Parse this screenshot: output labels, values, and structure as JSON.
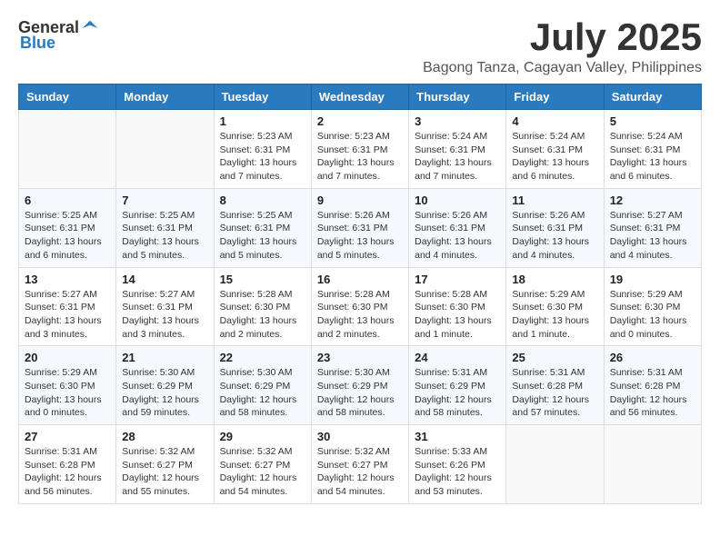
{
  "logo": {
    "general": "General",
    "blue": "Blue"
  },
  "title": "July 2025",
  "location": "Bagong Tanza, Cagayan Valley, Philippines",
  "weekdays": [
    "Sunday",
    "Monday",
    "Tuesday",
    "Wednesday",
    "Thursday",
    "Friday",
    "Saturday"
  ],
  "weeks": [
    [
      {
        "day": "",
        "sunrise": "",
        "sunset": "",
        "daylight": ""
      },
      {
        "day": "",
        "sunrise": "",
        "sunset": "",
        "daylight": ""
      },
      {
        "day": "1",
        "sunrise": "Sunrise: 5:23 AM",
        "sunset": "Sunset: 6:31 PM",
        "daylight": "Daylight: 13 hours and 7 minutes."
      },
      {
        "day": "2",
        "sunrise": "Sunrise: 5:23 AM",
        "sunset": "Sunset: 6:31 PM",
        "daylight": "Daylight: 13 hours and 7 minutes."
      },
      {
        "day": "3",
        "sunrise": "Sunrise: 5:24 AM",
        "sunset": "Sunset: 6:31 PM",
        "daylight": "Daylight: 13 hours and 7 minutes."
      },
      {
        "day": "4",
        "sunrise": "Sunrise: 5:24 AM",
        "sunset": "Sunset: 6:31 PM",
        "daylight": "Daylight: 13 hours and 6 minutes."
      },
      {
        "day": "5",
        "sunrise": "Sunrise: 5:24 AM",
        "sunset": "Sunset: 6:31 PM",
        "daylight": "Daylight: 13 hours and 6 minutes."
      }
    ],
    [
      {
        "day": "6",
        "sunrise": "Sunrise: 5:25 AM",
        "sunset": "Sunset: 6:31 PM",
        "daylight": "Daylight: 13 hours and 6 minutes."
      },
      {
        "day": "7",
        "sunrise": "Sunrise: 5:25 AM",
        "sunset": "Sunset: 6:31 PM",
        "daylight": "Daylight: 13 hours and 5 minutes."
      },
      {
        "day": "8",
        "sunrise": "Sunrise: 5:25 AM",
        "sunset": "Sunset: 6:31 PM",
        "daylight": "Daylight: 13 hours and 5 minutes."
      },
      {
        "day": "9",
        "sunrise": "Sunrise: 5:26 AM",
        "sunset": "Sunset: 6:31 PM",
        "daylight": "Daylight: 13 hours and 5 minutes."
      },
      {
        "day": "10",
        "sunrise": "Sunrise: 5:26 AM",
        "sunset": "Sunset: 6:31 PM",
        "daylight": "Daylight: 13 hours and 4 minutes."
      },
      {
        "day": "11",
        "sunrise": "Sunrise: 5:26 AM",
        "sunset": "Sunset: 6:31 PM",
        "daylight": "Daylight: 13 hours and 4 minutes."
      },
      {
        "day": "12",
        "sunrise": "Sunrise: 5:27 AM",
        "sunset": "Sunset: 6:31 PM",
        "daylight": "Daylight: 13 hours and 4 minutes."
      }
    ],
    [
      {
        "day": "13",
        "sunrise": "Sunrise: 5:27 AM",
        "sunset": "Sunset: 6:31 PM",
        "daylight": "Daylight: 13 hours and 3 minutes."
      },
      {
        "day": "14",
        "sunrise": "Sunrise: 5:27 AM",
        "sunset": "Sunset: 6:31 PM",
        "daylight": "Daylight: 13 hours and 3 minutes."
      },
      {
        "day": "15",
        "sunrise": "Sunrise: 5:28 AM",
        "sunset": "Sunset: 6:30 PM",
        "daylight": "Daylight: 13 hours and 2 minutes."
      },
      {
        "day": "16",
        "sunrise": "Sunrise: 5:28 AM",
        "sunset": "Sunset: 6:30 PM",
        "daylight": "Daylight: 13 hours and 2 minutes."
      },
      {
        "day": "17",
        "sunrise": "Sunrise: 5:28 AM",
        "sunset": "Sunset: 6:30 PM",
        "daylight": "Daylight: 13 hours and 1 minute."
      },
      {
        "day": "18",
        "sunrise": "Sunrise: 5:29 AM",
        "sunset": "Sunset: 6:30 PM",
        "daylight": "Daylight: 13 hours and 1 minute."
      },
      {
        "day": "19",
        "sunrise": "Sunrise: 5:29 AM",
        "sunset": "Sunset: 6:30 PM",
        "daylight": "Daylight: 13 hours and 0 minutes."
      }
    ],
    [
      {
        "day": "20",
        "sunrise": "Sunrise: 5:29 AM",
        "sunset": "Sunset: 6:30 PM",
        "daylight": "Daylight: 13 hours and 0 minutes."
      },
      {
        "day": "21",
        "sunrise": "Sunrise: 5:30 AM",
        "sunset": "Sunset: 6:29 PM",
        "daylight": "Daylight: 12 hours and 59 minutes."
      },
      {
        "day": "22",
        "sunrise": "Sunrise: 5:30 AM",
        "sunset": "Sunset: 6:29 PM",
        "daylight": "Daylight: 12 hours and 58 minutes."
      },
      {
        "day": "23",
        "sunrise": "Sunrise: 5:30 AM",
        "sunset": "Sunset: 6:29 PM",
        "daylight": "Daylight: 12 hours and 58 minutes."
      },
      {
        "day": "24",
        "sunrise": "Sunrise: 5:31 AM",
        "sunset": "Sunset: 6:29 PM",
        "daylight": "Daylight: 12 hours and 58 minutes."
      },
      {
        "day": "25",
        "sunrise": "Sunrise: 5:31 AM",
        "sunset": "Sunset: 6:28 PM",
        "daylight": "Daylight: 12 hours and 57 minutes."
      },
      {
        "day": "26",
        "sunrise": "Sunrise: 5:31 AM",
        "sunset": "Sunset: 6:28 PM",
        "daylight": "Daylight: 12 hours and 56 minutes."
      }
    ],
    [
      {
        "day": "27",
        "sunrise": "Sunrise: 5:31 AM",
        "sunset": "Sunset: 6:28 PM",
        "daylight": "Daylight: 12 hours and 56 minutes."
      },
      {
        "day": "28",
        "sunrise": "Sunrise: 5:32 AM",
        "sunset": "Sunset: 6:27 PM",
        "daylight": "Daylight: 12 hours and 55 minutes."
      },
      {
        "day": "29",
        "sunrise": "Sunrise: 5:32 AM",
        "sunset": "Sunset: 6:27 PM",
        "daylight": "Daylight: 12 hours and 54 minutes."
      },
      {
        "day": "30",
        "sunrise": "Sunrise: 5:32 AM",
        "sunset": "Sunset: 6:27 PM",
        "daylight": "Daylight: 12 hours and 54 minutes."
      },
      {
        "day": "31",
        "sunrise": "Sunrise: 5:33 AM",
        "sunset": "Sunset: 6:26 PM",
        "daylight": "Daylight: 12 hours and 53 minutes."
      },
      {
        "day": "",
        "sunrise": "",
        "sunset": "",
        "daylight": ""
      },
      {
        "day": "",
        "sunrise": "",
        "sunset": "",
        "daylight": ""
      }
    ]
  ]
}
